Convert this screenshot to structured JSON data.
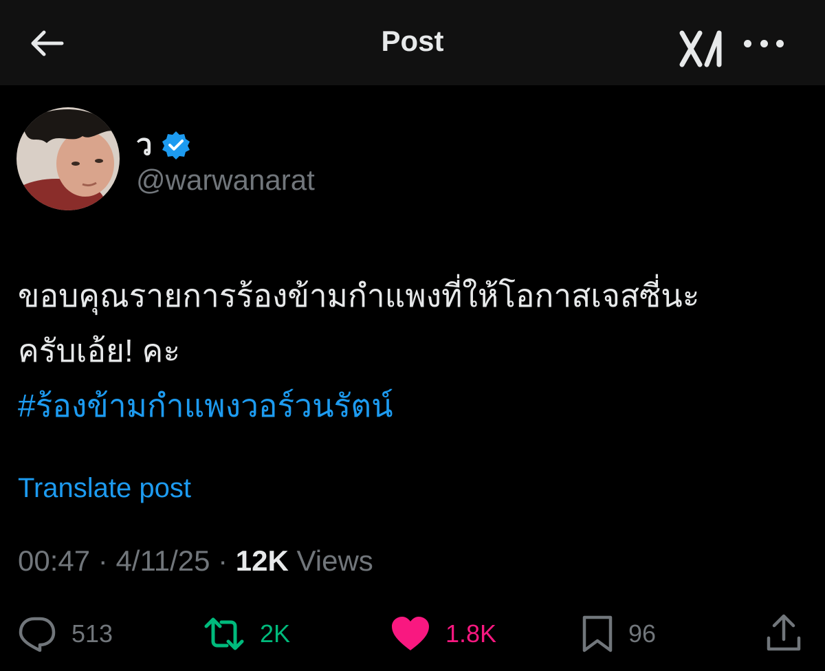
{
  "header": {
    "title": "Post",
    "back_icon": "arrow-left-icon",
    "grok_icon": "grok-icon",
    "more_icon": "more-horizontal-icon"
  },
  "author": {
    "display_name": "ว",
    "handle": "@warwanarat",
    "verified": true,
    "verified_color": "#1d9bf0"
  },
  "post": {
    "text_line1": "ขอบคุณรายการร้องข้ามกำแพงที่ให้โอกาสเจสซี่นะ",
    "text_line2": "ครับเอ้ย! คะ",
    "hashtag": "#ร้องข้ามกำแพงวอร์วนรัตน์",
    "translate_label": "Translate post",
    "time": "00:47",
    "date": "4/11/25",
    "views_count": "12K",
    "views_label": "Views"
  },
  "actions": {
    "replies": "513",
    "reposts": "2K",
    "likes": "1.8K",
    "bookmarks": "96"
  },
  "colors": {
    "accent": "#1d9bf0",
    "repost": "#00ba7c",
    "like": "#f91880",
    "muted": "#71767b"
  }
}
